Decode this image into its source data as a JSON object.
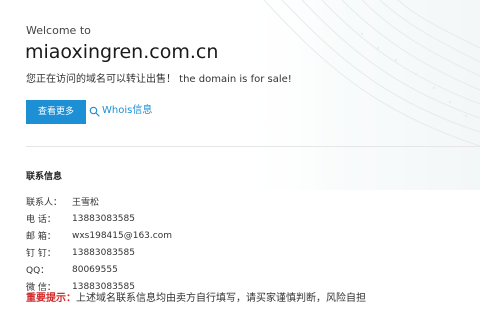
{
  "header": {
    "welcome": "Welcome to",
    "domain": "miaoxingren.com.cn",
    "sale_text": "您正在访问的域名可以转让出售！ the domain is for sale!"
  },
  "actions": {
    "more_label": "查看更多",
    "whois_label": "Whois信息"
  },
  "contact": {
    "title": "联系信息",
    "items": [
      {
        "label": "联系人：",
        "value": "王雪松"
      },
      {
        "label": "电  话：",
        "value": "13883083585"
      },
      {
        "label": "邮  箱：",
        "value": "wxs198415@163.com"
      },
      {
        "label": "钉  钉：",
        "value": "13883083585"
      },
      {
        "label": "QQ：",
        "value": "80069555"
      },
      {
        "label": "微  信：",
        "value": "13883083585"
      }
    ]
  },
  "notice": {
    "label": "重要提示：",
    "text": "上述域名联系信息均由卖方自行填写，请买家谨慎判断，风险自担"
  },
  "colors": {
    "accent": "#1d8fd4",
    "warning": "#d12b2b",
    "divider": "#e6e6e6",
    "watermark": "#eef3f4"
  },
  "icons": {
    "whois": "search-icon"
  }
}
